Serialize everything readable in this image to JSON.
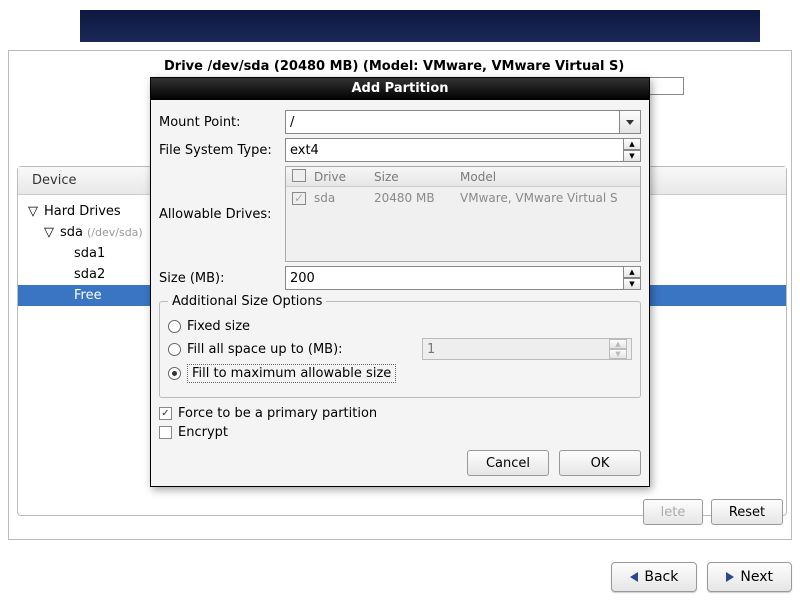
{
  "drive_caption": "Drive /dev/sda (20480 MB) (Model: VMware, VMware Virtual S)",
  "tree_header": {
    "device": "Device"
  },
  "tree": {
    "root": "Hard Drives",
    "disk": "sda",
    "disk_dim": "(/dev/sda)",
    "p1": "sda1",
    "p2": "sda2",
    "free": "Free"
  },
  "buttons": {
    "delete": "lete",
    "reset": "Reset",
    "back": "Back",
    "next": "Next"
  },
  "dialog": {
    "title": "Add Partition",
    "mount_label": "Mount Point:",
    "mount_value": "/",
    "fs_label": "File System Type:",
    "fs_value": "ext4",
    "drives_label": "Allowable Drives:",
    "drives_head": {
      "c1": "Drive",
      "c2": "Size",
      "c3": "Model"
    },
    "drives_row": {
      "name": "sda",
      "size": "20480 MB",
      "model": "VMware, VMware Virtual S"
    },
    "size_label": "Size (MB):",
    "size_value": "200",
    "group_label": "Additional Size Options",
    "opt1": "Fixed size",
    "opt2": "Fill all space up to (MB):",
    "opt2_value": "1",
    "opt3": "Fill to maximum allowable size",
    "chk1": "Force to be a primary partition",
    "chk2": "Encrypt",
    "cancel": "Cancel",
    "ok": "OK"
  }
}
